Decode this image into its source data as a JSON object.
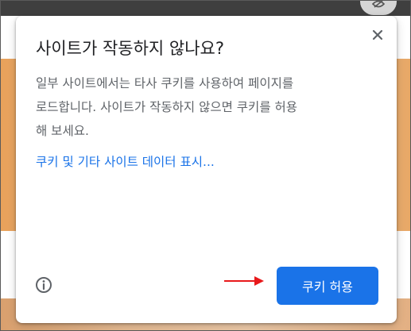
{
  "dialog": {
    "title": "사이트가 작동하지 않나요?",
    "body_lines": [
      "일부 사이트에서는 타사 쿠키를 사용하여 페이지를",
      "로드합니다. 사이트가 작동하지 않으면 쿠키를 허용",
      "해 보세요."
    ],
    "link_text": "쿠키 및 기타 사이트 데이터 표시...",
    "allow_button_label": "쿠키 허용",
    "icons": {
      "close": "close-icon",
      "info": "info-icon",
      "annotation_arrow": "arrow-right-icon",
      "background_control": "eye-icon"
    }
  },
  "colors": {
    "accent": "#1a73e8",
    "title_text": "#202124",
    "body_text": "#5f6368",
    "annotation_arrow": "#e8191b"
  }
}
